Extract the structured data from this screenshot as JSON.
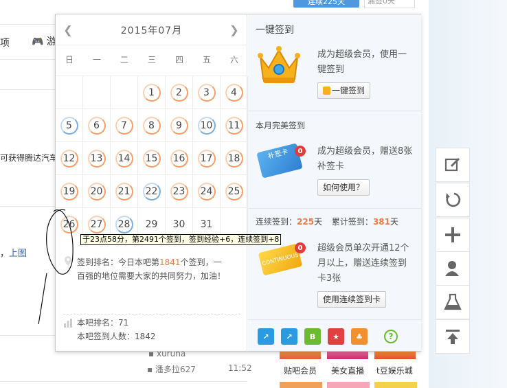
{
  "topbar": {
    "signin_days": "连续225天",
    "right_text": "漏签0天"
  },
  "background": {
    "tab_partial": "项",
    "game_partial": "游",
    "promo_partial": "可获得腾达汽车",
    "line2_prefix": "，",
    "line2_link": "上图",
    "user1": "xuruna",
    "user2": "潘多拉627",
    "time2": "11:52",
    "cards": [
      "贴吧会员",
      "美女直播",
      "t豆娱乐城"
    ]
  },
  "calendar": {
    "title": "2015年07月",
    "weekdays": [
      "日",
      "一",
      "二",
      "三",
      "四",
      "五",
      "六"
    ],
    "rows": [
      [
        {
          "d": "",
          "s": "empty"
        },
        {
          "d": "",
          "s": "empty"
        },
        {
          "d": "",
          "s": "empty"
        },
        {
          "d": "1",
          "s": "orange"
        },
        {
          "d": "2",
          "s": "orange"
        },
        {
          "d": "3",
          "s": "orange"
        },
        {
          "d": "4",
          "s": "orange"
        }
      ],
      [
        {
          "d": "5",
          "s": "blue"
        },
        {
          "d": "6",
          "s": "orange"
        },
        {
          "d": "7",
          "s": "orange"
        },
        {
          "d": "8",
          "s": "orange"
        },
        {
          "d": "9",
          "s": "orange"
        },
        {
          "d": "10",
          "s": "blue"
        },
        {
          "d": "11",
          "s": "orange"
        }
      ],
      [
        {
          "d": "12",
          "s": "orange"
        },
        {
          "d": "13",
          "s": "orange"
        },
        {
          "d": "14",
          "s": "orange"
        },
        {
          "d": "15",
          "s": "orange"
        },
        {
          "d": "16",
          "s": "orange"
        },
        {
          "d": "17",
          "s": "orange"
        },
        {
          "d": "18",
          "s": "orange"
        }
      ],
      [
        {
          "d": "19",
          "s": "orange"
        },
        {
          "d": "20",
          "s": "orange"
        },
        {
          "d": "21",
          "s": "orange"
        },
        {
          "d": "22",
          "s": "blue"
        },
        {
          "d": "23",
          "s": "orange"
        },
        {
          "d": "24",
          "s": "orange"
        },
        {
          "d": "25",
          "s": "orange"
        }
      ],
      [
        {
          "d": "26",
          "s": "orange"
        },
        {
          "d": "27",
          "s": "orange"
        },
        {
          "d": "28",
          "s": "blue"
        },
        {
          "d": "29",
          "s": "none"
        },
        {
          "d": "30",
          "s": "none"
        },
        {
          "d": "31",
          "s": "none"
        },
        {
          "d": "",
          "s": "empty"
        }
      ]
    ],
    "tooltip": "于23点58分，第2491个签到，签到经验+6，连续签到+8",
    "rank_prefix": "签到排名：今日本吧第",
    "rank_num": "1841",
    "rank_suffix": "个签到，一百强的地位需要大家的共同努力，加油！",
    "bar_rank": "本吧排名：71",
    "bar_count": "本吧签到人数：1842"
  },
  "side": {
    "title": "一键签到",
    "vip_desc": "成为超级会员，使用一键签到",
    "onekey_btn": "一键签到",
    "perfect_title": "本月完美签到",
    "card1_label": "补签卡",
    "card1_badge": "0",
    "card1_desc": "成为超级会员，赠送8张补签卡",
    "howto_btn": "如何使用？",
    "streak_label": "连续签到：",
    "streak_num": "225",
    "streak_unit": "天",
    "total_label": "累计签到：",
    "total_num": "381",
    "total_unit": "天",
    "card2_label": "CONTINUOUS",
    "card2_badge": "0",
    "card2_desc": "超级会员单次开通12个月以上，赠送连续签到卡3张",
    "use_btn": "使用连续签到卡",
    "help": "?"
  },
  "colors": {
    "orange": "#f07b3d",
    "blue": "#79aee3",
    "link": "#2d64b3"
  }
}
